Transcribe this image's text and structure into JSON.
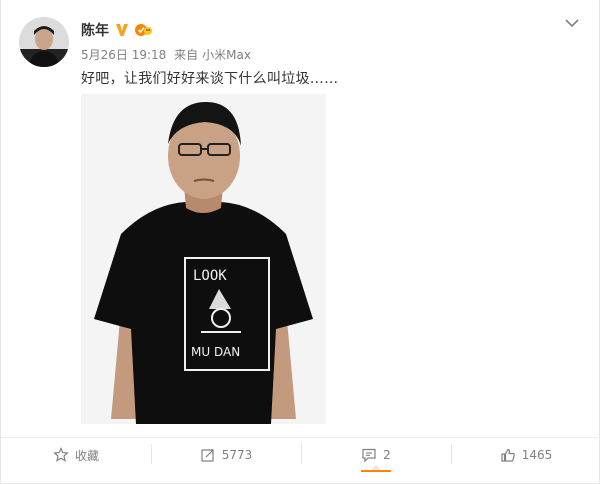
{
  "post": {
    "author": "陈年",
    "date": "5月26日 19:18",
    "via": "来自",
    "source": "小米Max",
    "text": "好吧，让我们好好来谈下什么叫垃圾……",
    "photo_caption_lines": [
      "LOOK",
      "MU DAN"
    ]
  },
  "actions": {
    "favorite_label": "收藏",
    "repost_count": "5773",
    "comment_count": "2",
    "like_count": "1465"
  },
  "colors": {
    "accent": "#ff8200",
    "verified": "#f7a41d",
    "muted": "#808080"
  },
  "icons": [
    "avatar",
    "verified-icon",
    "vip-icon",
    "chevron-down-icon",
    "star-icon",
    "repost-icon",
    "comment-icon",
    "like-icon"
  ]
}
